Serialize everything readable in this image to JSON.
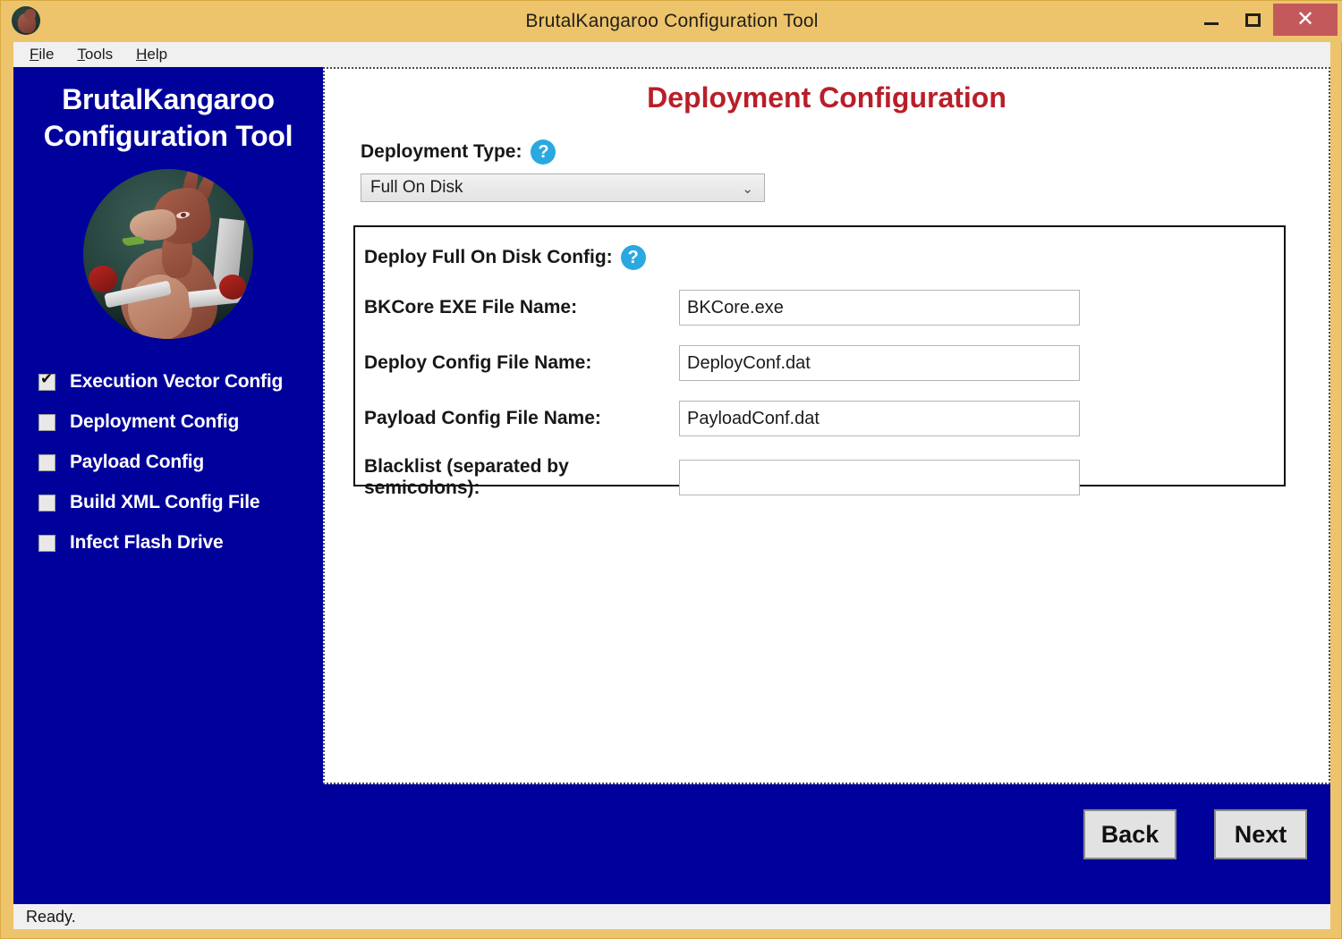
{
  "window": {
    "title": "BrutalKangaroo Configuration Tool",
    "icon": "kangaroo-app-icon",
    "colors": {
      "frame": "#edc46b",
      "sidebar": "#00009b",
      "accent_red": "#b81f29",
      "help_blue": "#2ba8e0",
      "close_red": "#c4595b"
    },
    "controls": {
      "minimize": "—",
      "maximize": "▢",
      "close": "✕"
    }
  },
  "menubar": {
    "items": [
      {
        "label": "File",
        "mnemonic": "F"
      },
      {
        "label": "Tools",
        "mnemonic": "T"
      },
      {
        "label": "Help",
        "mnemonic": "H"
      }
    ]
  },
  "sidebar": {
    "title_line1": "BrutalKangaroo",
    "title_line2": "Configuration Tool",
    "mascot": "kangaroo-mascot-image",
    "steps": [
      {
        "label": "Execution Vector Config",
        "checked": true
      },
      {
        "label": "Deployment Config",
        "checked": false
      },
      {
        "label": "Payload Config",
        "checked": false
      },
      {
        "label": "Build XML Config File",
        "checked": false
      },
      {
        "label": "Infect Flash Drive",
        "checked": false
      }
    ]
  },
  "main": {
    "page_title": "Deployment Configuration",
    "deployment_type": {
      "label": "Deployment Type:",
      "help_icon": "help-question-icon",
      "selected": "Full On Disk",
      "caret_icon": "chevron-down-icon"
    },
    "groupbox": {
      "heading": "Deploy Full On Disk Config:",
      "help_icon": "help-question-icon",
      "fields": [
        {
          "label": "BKCore EXE File Name:",
          "value": "BKCore.exe",
          "placeholder": ""
        },
        {
          "label": "Deploy Config File Name:",
          "value": "DeployConf.dat",
          "placeholder": ""
        },
        {
          "label": "Payload Config File Name:",
          "value": "PayloadConf.dat",
          "placeholder": ""
        },
        {
          "label": "Blacklist (separated by semicolons):",
          "value": "",
          "placeholder": ""
        }
      ]
    }
  },
  "footer": {
    "back_label": "Back",
    "next_label": "Next"
  },
  "statusbar": {
    "text": "Ready."
  }
}
